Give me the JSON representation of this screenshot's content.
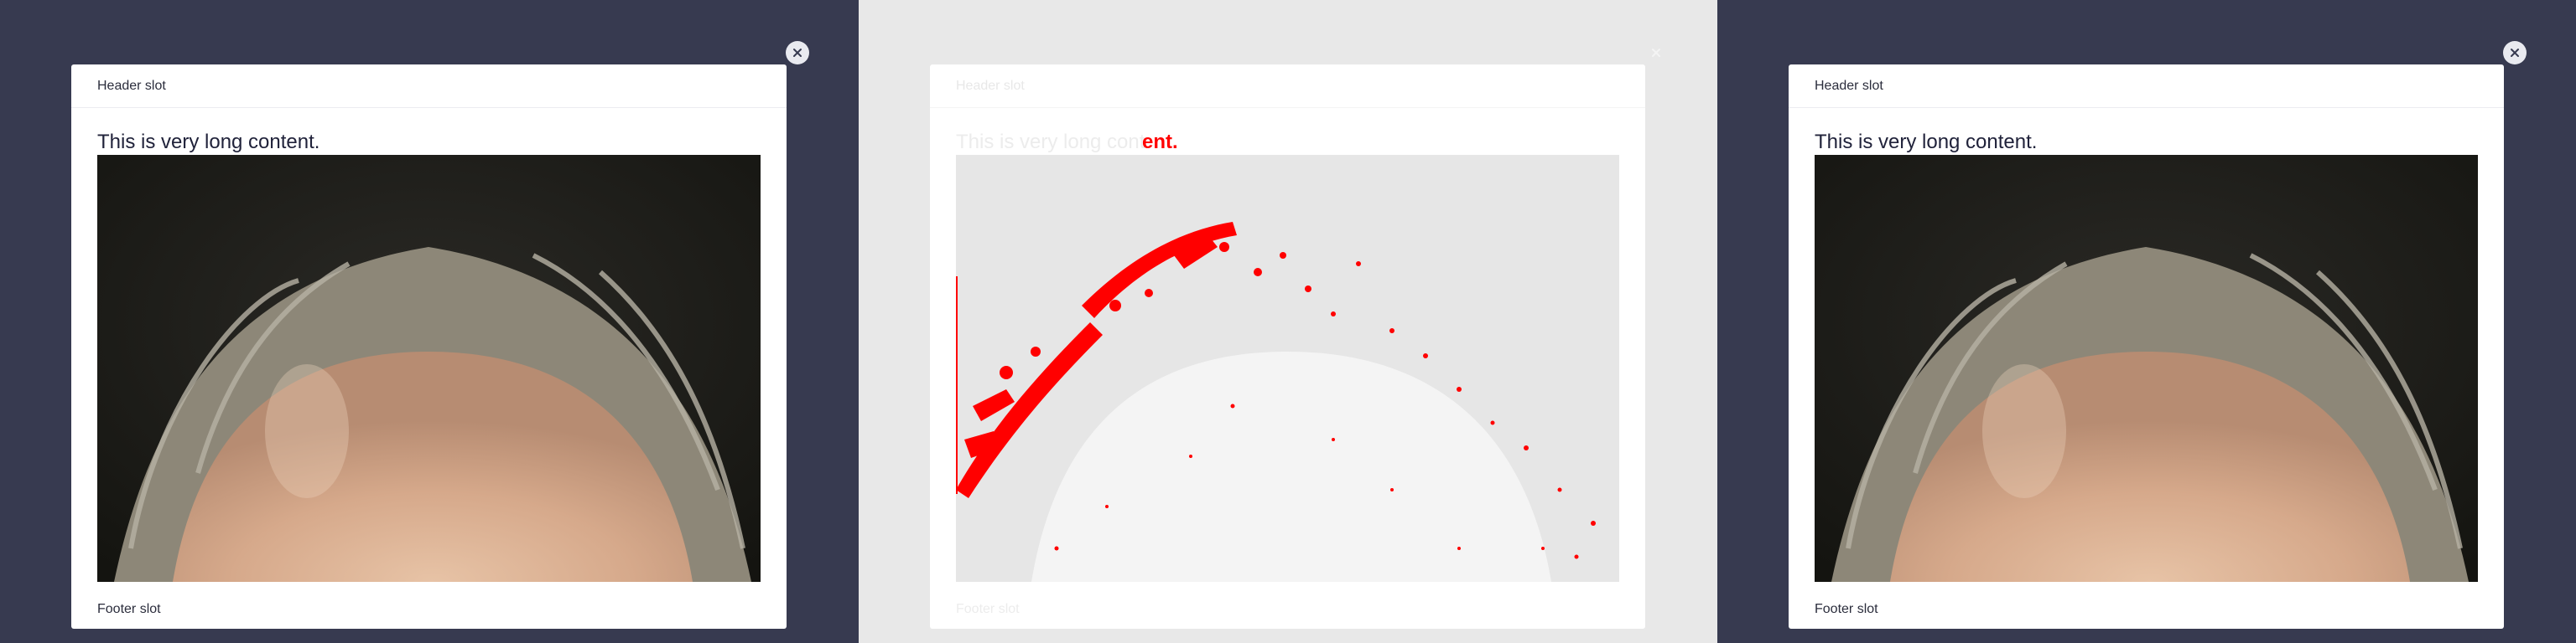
{
  "panels": [
    {
      "id": "left",
      "header": "Header slot",
      "content": "This is very long content.",
      "footer": "Footer slot"
    },
    {
      "id": "diff",
      "header": "Header slot",
      "content_prefix": "This is very long cont",
      "content_diff": "ent.",
      "footer": "Footer slot"
    },
    {
      "id": "right",
      "header": "Header slot",
      "content": "This is very long content.",
      "footer": "Footer slot"
    }
  ],
  "colors": {
    "backdrop": "#373a50",
    "diff_background": "#e8e8e8",
    "diff_highlight": "#ff0000",
    "modal": "#ffffff"
  },
  "icons": {
    "close": "close-icon"
  }
}
